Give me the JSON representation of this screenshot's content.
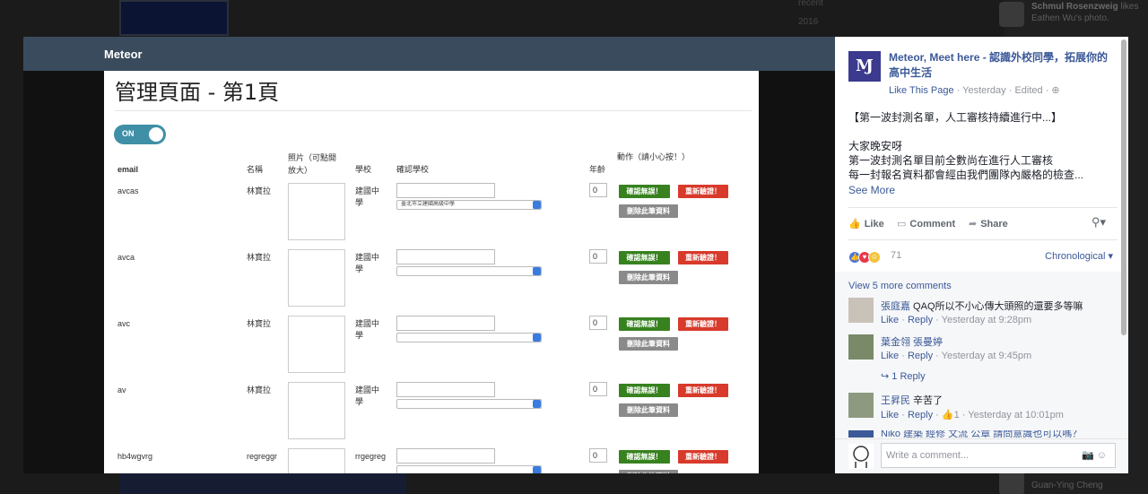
{
  "background": {
    "right_rows": [
      {
        "name": "Schmul Rosenzweig",
        "text": "likes"
      },
      {
        "name": "",
        "text": "Eathen Wu's photo."
      },
      {
        "name": "",
        "text": "Guan-Ying Cheng"
      }
    ],
    "mid_texts": [
      "recent",
      "2016"
    ]
  },
  "app": {
    "brand": "Meteor",
    "page_title": "管理頁面 - 第1頁",
    "toggle_label": "ON",
    "columns": {
      "email": "email",
      "name": "名稱",
      "photo": "照片（可點開放大）",
      "school": "學校",
      "confirm_school": "確認學校",
      "age": "年齡",
      "action": "動作（請小心按！）"
    },
    "buttons": {
      "confirm": "確認無誤！",
      "reverify": "重新驗證！",
      "delete": "刪除此筆資料"
    },
    "rows": [
      {
        "email": "avcas",
        "name": "林寶拉",
        "school": "建國中學",
        "select": "臺北市立建國高級中學",
        "age": "0"
      },
      {
        "email": "avca",
        "name": "林寶拉",
        "school": "建國中學",
        "select": "",
        "age": "0"
      },
      {
        "email": "avc",
        "name": "林寶拉",
        "school": "建國中學",
        "select": "",
        "age": "0"
      },
      {
        "email": "av",
        "name": "林寶拉",
        "school": "建國中學",
        "select": "",
        "age": "0"
      },
      {
        "email": "hb4wgvrg",
        "name": "regreggr",
        "school": "rrgegreg",
        "select": "",
        "age": "0"
      }
    ]
  },
  "fb": {
    "logo_text": "Ɱ",
    "page_name": "Meteor, Meet here - 認識外校同學，拓展你的高中生活",
    "like_page": "Like This Page",
    "meta": " · Yesterday · Edited · ",
    "globe": "⊕",
    "post_lines": [
      "【第一波封測名單，人工審核持續進行中...】",
      "",
      "大家晚安呀",
      "第一波封測名單目前全數尚在進行人工審核",
      "每一封報名資料都會經由我們團隊內嚴格的檢查..."
    ],
    "see_more": "See More",
    "actions": {
      "like": "Like",
      "comment": "Comment",
      "share": "Share"
    },
    "reactions": {
      "count": "71",
      "order": "Chronological"
    },
    "view_more": "View 5 more comments",
    "comments": [
      {
        "name": "張庭嘉",
        "text": " QAQ所以不小心傳大頭照的還要多等嘛",
        "like": "Like",
        "reply": "Reply",
        "time": "Yesterday at 9:28pm"
      },
      {
        "name": "葉金翎",
        "text": " 張曼婷",
        "like": "Like",
        "reply": "Reply",
        "time": "Yesterday at 9:45pm"
      },
      {
        "name": "王昇民",
        "text": " 辛苦了",
        "like": "Like",
        "reply": "Reply",
        "likes": "1",
        "time": "Yesterday at 10:01pm"
      }
    ],
    "replies_link": "↪ 1 Reply",
    "cut_comment": "Niko 建築 經修 文流 公章 請問意識也可以嗎？",
    "write_placeholder": "Write a comment..."
  }
}
